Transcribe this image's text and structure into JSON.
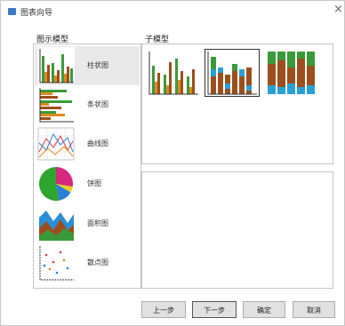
{
  "window": {
    "title": "图表向导",
    "title_icon": "chart-wizard-icon",
    "close_icon": "close-icon",
    "close_glyph": "×"
  },
  "left_panel": {
    "label": "图示模型",
    "items": [
      {
        "label": "柱状图",
        "icon": "bar-chart-icon",
        "selected": true
      },
      {
        "label": "条状图",
        "icon": "horizontal-bar-chart-icon",
        "selected": false
      },
      {
        "label": "曲线图",
        "icon": "line-chart-icon",
        "selected": false
      },
      {
        "label": "饼图",
        "icon": "pie-chart-icon",
        "selected": false
      },
      {
        "label": "面积图",
        "icon": "area-chart-icon",
        "selected": false
      },
      {
        "label": "散点图",
        "icon": "scatter-chart-icon",
        "selected": false
      }
    ]
  },
  "right_panel": {
    "label": "子模型",
    "subtypes": [
      {
        "icon": "clustered-column-icon",
        "selected": false
      },
      {
        "icon": "stacked-column-icon",
        "selected": true
      },
      {
        "icon": "percent-stacked-column-icon",
        "selected": false
      }
    ]
  },
  "buttons": {
    "prev": "上一步",
    "next": "下一步",
    "ok": "确定",
    "cancel": "取消"
  },
  "colors": {
    "green": "#3a9a3a",
    "orange": "#e08a1e",
    "brown": "#9c4f1c",
    "blue": "#2a9fd6",
    "magenta": "#d6287c",
    "yellow": "#e8d21a",
    "red": "#d83a3a"
  }
}
